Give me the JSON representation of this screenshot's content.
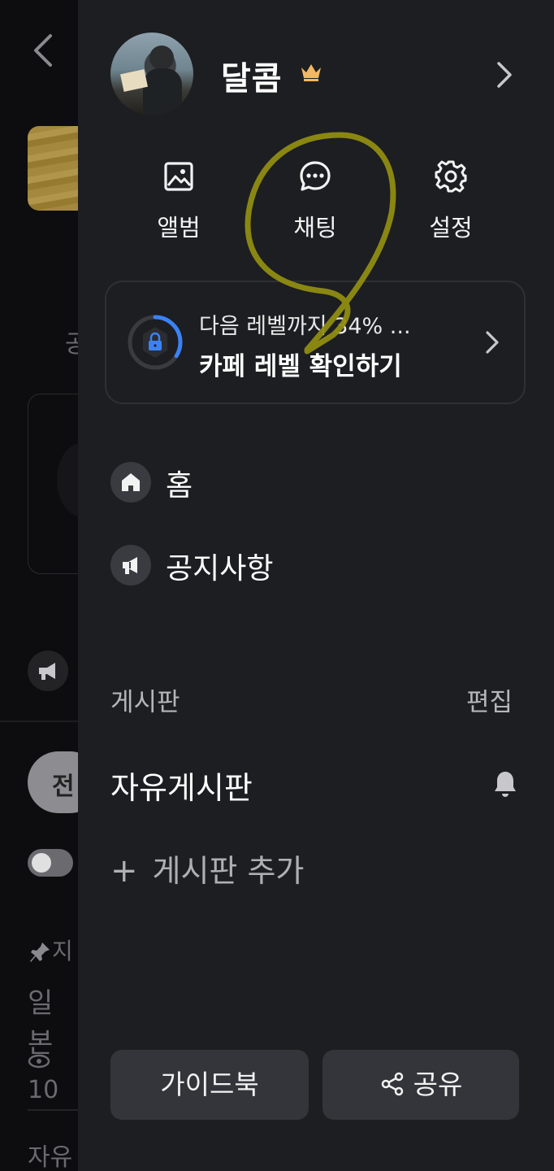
{
  "background": {
    "visible_fragments": [
      "공",
      "전",
      "지",
      "일본",
      "10",
      "자유"
    ]
  },
  "profile": {
    "nickname": "달콤",
    "crown_icon": "crown-icon",
    "arrow_icon": "chevron-right-icon"
  },
  "quick_actions": [
    {
      "label": "앨범",
      "icon": "image-icon"
    },
    {
      "label": "채팅",
      "icon": "chat-bubble-icon"
    },
    {
      "label": "설정",
      "icon": "gear-icon"
    }
  ],
  "level_card": {
    "progress_text": "다음 레벨까지 34% ...",
    "title": "카페 레벨 확인하기",
    "progress_percent": 34,
    "icon": "lock-icon"
  },
  "menu": [
    {
      "label": "홈",
      "icon": "home-icon"
    },
    {
      "label": "공지사항",
      "icon": "megaphone-icon"
    }
  ],
  "boards_section": {
    "title": "게시판",
    "edit_label": "편집",
    "items": [
      {
        "label": "자유게시판",
        "icon": "bell-icon"
      }
    ],
    "add_label": "게시판 추가"
  },
  "buttons": {
    "guide": "가이드북",
    "share": "공유"
  },
  "colors": {
    "drawer_bg": "#1d1e21",
    "accent_blue": "#3b82f6",
    "crown": "#f4b860",
    "annotation": "#8f8d12"
  }
}
